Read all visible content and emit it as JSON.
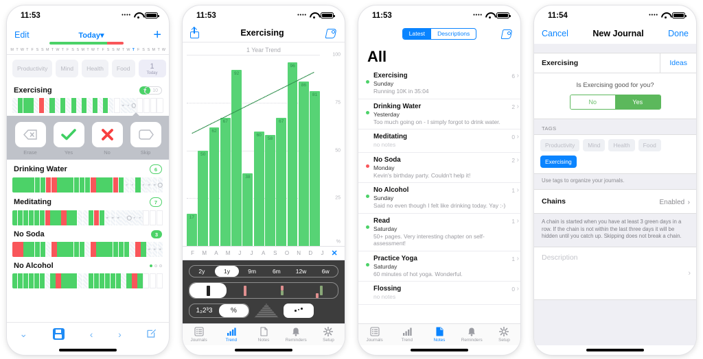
{
  "screen1": {
    "status": {
      "time": "11:53"
    },
    "nav": {
      "edit": "Edit",
      "today": "Today",
      "chevron": "▾",
      "plus": "+"
    },
    "progress": {
      "green_pct": 78,
      "red_pct": 22
    },
    "weekdays": [
      "M",
      "T",
      "W",
      "T",
      "F",
      "S",
      "S",
      "M",
      "T",
      "W",
      "T",
      "F",
      "S",
      "S",
      "M",
      "T",
      "W",
      "T",
      "F",
      "S",
      "S",
      "M",
      "T",
      "W",
      "T",
      "F",
      "S",
      "S",
      "M",
      "T",
      "W"
    ],
    "today_index": 24,
    "tags": [
      "Productivity",
      "Mind",
      "Health",
      "Food"
    ],
    "today_chip": {
      "count": "1",
      "label": "Today"
    },
    "habits": [
      {
        "name": "Exercising",
        "badge": "7",
        "badge_outline": "10",
        "style": "pair"
      },
      {
        "name": "Drinking Water",
        "badge": "6",
        "style": "single"
      },
      {
        "name": "Meditating",
        "badge": "7",
        "style": "single"
      },
      {
        "name": "No Soda",
        "badge": "3",
        "style": "single"
      },
      {
        "name": "No Alcohol",
        "style": "dots"
      }
    ],
    "actions": [
      {
        "label": "Erase",
        "icon": "erase-icon"
      },
      {
        "label": "Yes",
        "icon": "check-icon"
      },
      {
        "label": "No",
        "icon": "cross-icon"
      },
      {
        "label": "Skip",
        "icon": "tag-icon"
      }
    ],
    "toolbar": [
      {
        "name": "collapse-chevron-icon",
        "glyph": "⌄"
      },
      {
        "name": "save-icon",
        "glyph": ""
      },
      {
        "name": "previous-icon",
        "glyph": "‹"
      },
      {
        "name": "next-icon",
        "glyph": "›"
      },
      {
        "name": "compose-icon",
        "glyph": ""
      }
    ]
  },
  "screen2": {
    "status": {
      "time": "11:53"
    },
    "nav": {
      "title": "Exercising",
      "share_icon": "share-icon",
      "tag_icon": "tag-icon"
    },
    "range_options": [
      "2y",
      "1y",
      "9m",
      "6m",
      "12w",
      "6w"
    ],
    "range_selected": "1y",
    "style_selected": "solid",
    "number_options": [
      "1₂2³3",
      "%"
    ],
    "number_selected": "%",
    "tabs": [
      {
        "label": "Journals",
        "icon": "journals-icon",
        "active": false
      },
      {
        "label": "Trend",
        "icon": "trend-icon",
        "active": true
      },
      {
        "label": "Notes",
        "icon": "notes-icon",
        "active": false
      },
      {
        "label": "Reminders",
        "icon": "reminders-icon",
        "active": false
      },
      {
        "label": "Setup",
        "icon": "setup-icon",
        "active": false
      }
    ],
    "chart_data": {
      "type": "bar",
      "title": "1 Year Trend",
      "xlabel": "",
      "ylabel": "%",
      "categories": [
        "F",
        "M",
        "A",
        "M",
        "J",
        "J",
        "A",
        "S",
        "O",
        "N",
        "D",
        "J"
      ],
      "values": [
        17,
        50,
        62,
        67,
        92,
        38,
        60,
        58,
        67,
        96,
        86,
        81
      ],
      "ylim": [
        0,
        100
      ],
      "yticks": [
        25,
        50,
        75,
        100
      ],
      "grid": true,
      "legend": "none",
      "series": [
        {
          "name": "Completion %",
          "values": [
            17,
            50,
            62,
            67,
            92,
            38,
            60,
            58,
            67,
            96,
            86,
            81
          ]
        },
        {
          "name": "Trend line",
          "type": "line",
          "x": [
            0,
            11
          ],
          "y": [
            41,
            87
          ]
        }
      ],
      "bar_color": "#57d375",
      "trend_color": "#2f8f4c"
    }
  },
  "screen3": {
    "status": {
      "time": "11:53"
    },
    "segments": [
      "Latest",
      "Descriptions"
    ],
    "segment_selected": "Latest",
    "tag_icon": "tag-icon",
    "title": "All",
    "notes": [
      {
        "title": "Exercising",
        "day": "Sunday",
        "body": "Running 10K in 35:04",
        "count": "6",
        "dot": "green"
      },
      {
        "title": "Drinking Water",
        "day": "Yesterday",
        "body": "Too much going on - I simply forgot to drink water.",
        "count": "2",
        "dot": "green"
      },
      {
        "title": "Meditating",
        "day": "",
        "body": "no notes",
        "count": "0",
        "dot": "none"
      },
      {
        "title": "No Soda",
        "day": "Monday",
        "body": "Kevin's birthday party. Couldn't help it!",
        "count": "2",
        "dot": "red"
      },
      {
        "title": "No Alcohol",
        "day": "Sunday",
        "body": "Said no even though I felt like drinking today. Yay :-)",
        "count": "1",
        "dot": "green"
      },
      {
        "title": "Read",
        "day": "Saturday",
        "body": "50+ pages. Very interesting chapter on self-assessment!",
        "count": "1",
        "dot": "green"
      },
      {
        "title": "Practice Yoga",
        "day": "Saturday",
        "body": "60 minutes of hot yoga. Wonderful.",
        "count": "1",
        "dot": "green"
      },
      {
        "title": "Flossing",
        "day": "",
        "body": "no notes",
        "count": "0",
        "dot": "none"
      }
    ],
    "tabs": [
      {
        "label": "Journals",
        "icon": "journals-icon",
        "active": false
      },
      {
        "label": "Trend",
        "icon": "trend-icon",
        "active": false
      },
      {
        "label": "Notes",
        "icon": "notes-icon",
        "active": true
      },
      {
        "label": "Reminders",
        "icon": "reminders-icon",
        "active": false
      },
      {
        "label": "Setup",
        "icon": "setup-icon",
        "active": false
      }
    ]
  },
  "screen4": {
    "status": {
      "time": "11:54"
    },
    "nav": {
      "cancel": "Cancel",
      "title": "New Journal",
      "done": "Done"
    },
    "journal_name": "Exercising",
    "ideas_label": "Ideas",
    "question": "Is Exercising good for you?",
    "answers": {
      "no": "No",
      "yes": "Yes",
      "selected": "Yes"
    },
    "tags_label": "TAGS",
    "tags": [
      "Productivity",
      "Mind",
      "Health",
      "Food"
    ],
    "tag_selected": "Exercising",
    "tags_hint": "Use tags to organize your journals.",
    "chains": {
      "label": "Chains",
      "value": "Enabled",
      "chevron": "›"
    },
    "chains_desc": "A chain is started when you have at least 3 green days in a row. If the chain is not within the last three days it will be hidden until you catch up. Skipping does not break a chain.",
    "description_placeholder": "Description"
  },
  "colors": {
    "green": "#4cd268",
    "red": "#f9565a",
    "blue": "#0a84ff",
    "bar": "#57d375"
  }
}
